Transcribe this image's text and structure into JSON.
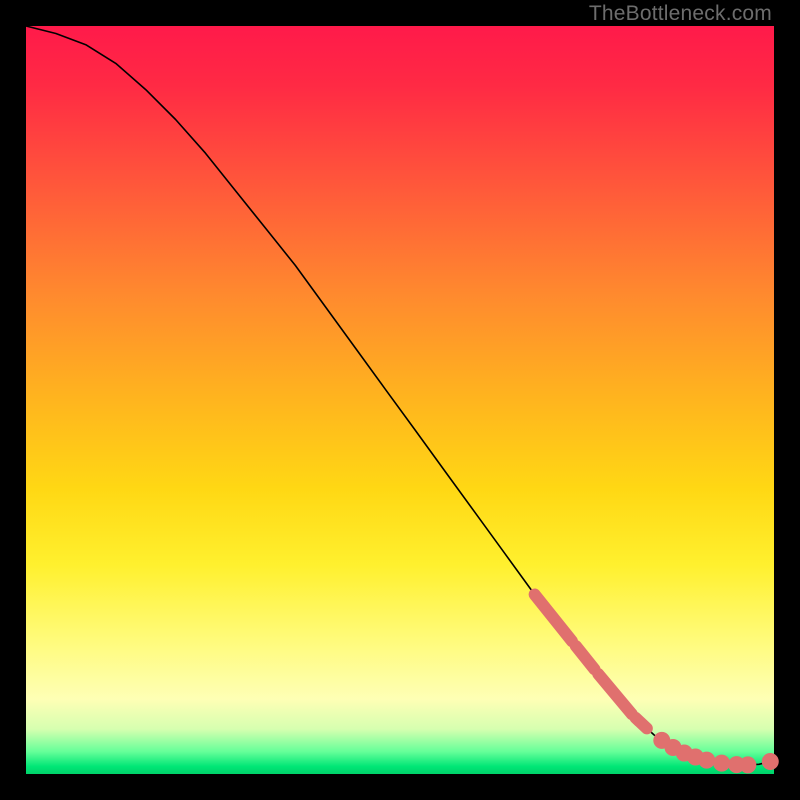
{
  "watermark": "TheBottleneck.com",
  "chart_data": {
    "type": "line",
    "title": "",
    "xlabel": "",
    "ylabel": "",
    "xlim": [
      0,
      100
    ],
    "ylim": [
      0,
      100
    ],
    "series": [
      {
        "name": "curve",
        "x": [
          0,
          4,
          8,
          12,
          16,
          20,
          24,
          28,
          32,
          36,
          40,
          44,
          48,
          52,
          56,
          60,
          64,
          68,
          72,
          76,
          80,
          82,
          84,
          86,
          88,
          90,
          92,
          94,
          96,
          98,
          100
        ],
        "y": [
          100,
          99,
          97.5,
          95,
          91.5,
          87.5,
          83,
          78,
          73,
          68,
          62.5,
          57,
          51.5,
          46,
          40.5,
          35,
          29.5,
          24,
          19,
          14,
          9,
          7,
          5.2,
          3.8,
          2.8,
          2.1,
          1.6,
          1.3,
          1.2,
          1.3,
          1.8
        ]
      }
    ],
    "highlight_segments": [
      {
        "x0": 68,
        "x1": 73
      },
      {
        "x0": 73.5,
        "x1": 76
      },
      {
        "x0": 76.5,
        "x1": 81
      },
      {
        "x0": 81.5,
        "x1": 83
      }
    ],
    "highlight_points_x": [
      85,
      86.5,
      88,
      89.5,
      91,
      93,
      95,
      96.5,
      99.5
    ],
    "colors": {
      "line": "#000000",
      "highlight": "#e0706e",
      "gradient_top": "#ff1a4a",
      "gradient_bottom": "#00d26a"
    }
  }
}
